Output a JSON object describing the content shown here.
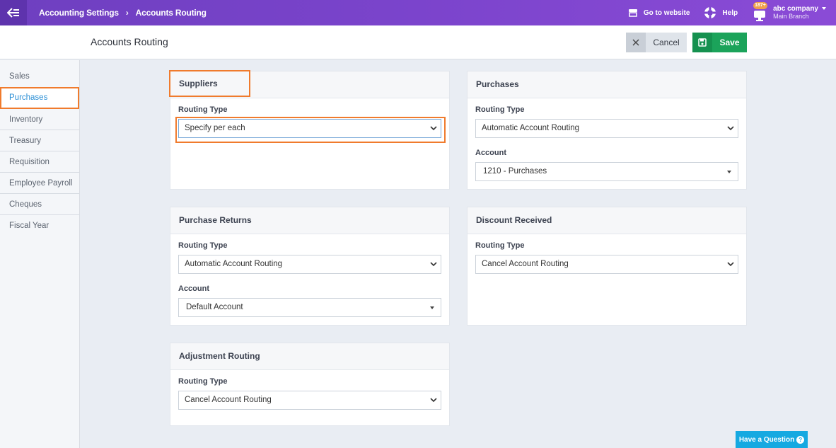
{
  "topbar": {
    "breadcrumb": [
      "Accounting Settings",
      "Accounts Routing"
    ],
    "go_to_website": "Go to website",
    "help": "Help",
    "badge": "187+",
    "company": "abc company",
    "branch": "Main Branch"
  },
  "header": {
    "title": "Accounts Routing",
    "cancel_label": "Cancel",
    "save_label": "Save"
  },
  "sidebar": {
    "items": [
      "Sales",
      "Purchases",
      "Inventory",
      "Treasury",
      "Requisition",
      "Employee Payroll",
      "Cheques",
      "Fiscal Year"
    ],
    "active": "Purchases"
  },
  "cards": {
    "suppliers": {
      "title": "Suppliers",
      "routing_label": "Routing Type",
      "routing_value": "Specify per each"
    },
    "purchases": {
      "title": "Purchases",
      "routing_label": "Routing Type",
      "routing_value": "Automatic Account Routing",
      "account_label": "Account",
      "account_value": "1210 - Purchases"
    },
    "purchase_returns": {
      "title": "Purchase Returns",
      "routing_label": "Routing Type",
      "routing_value": "Automatic Account Routing",
      "account_label": "Account",
      "account_value": "Default Account"
    },
    "discount_received": {
      "title": "Discount Received",
      "routing_label": "Routing Type",
      "routing_value": "Cancel Account Routing"
    },
    "adjustment_routing": {
      "title": "Adjustment Routing",
      "routing_label": "Routing Type",
      "routing_value": "Cancel Account Routing"
    }
  },
  "help_widget": {
    "label": "Have a Question"
  },
  "colors": {
    "topbar": "#7b44cc",
    "save": "#1ba35a",
    "highlight": "#f07b2d",
    "active_link": "#2b8fd6",
    "help": "#15a9e1"
  }
}
